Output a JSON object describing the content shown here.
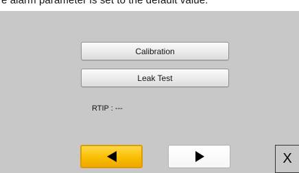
{
  "header": {
    "caption": "e alarm parameter is set to the default value."
  },
  "menu": {
    "calibration_label": "Calibration",
    "leak_test_label": "Leak Test"
  },
  "status": {
    "rtip_text": "RTIP : ---"
  },
  "navigation": {
    "prev_icon": "left-arrow-icon",
    "next_icon": "right-arrow-icon",
    "close_label": "X"
  },
  "colors": {
    "panel_bg": "#c8c8c8",
    "accent_prev": "#f9be00",
    "button_face": "#eeeeee"
  }
}
